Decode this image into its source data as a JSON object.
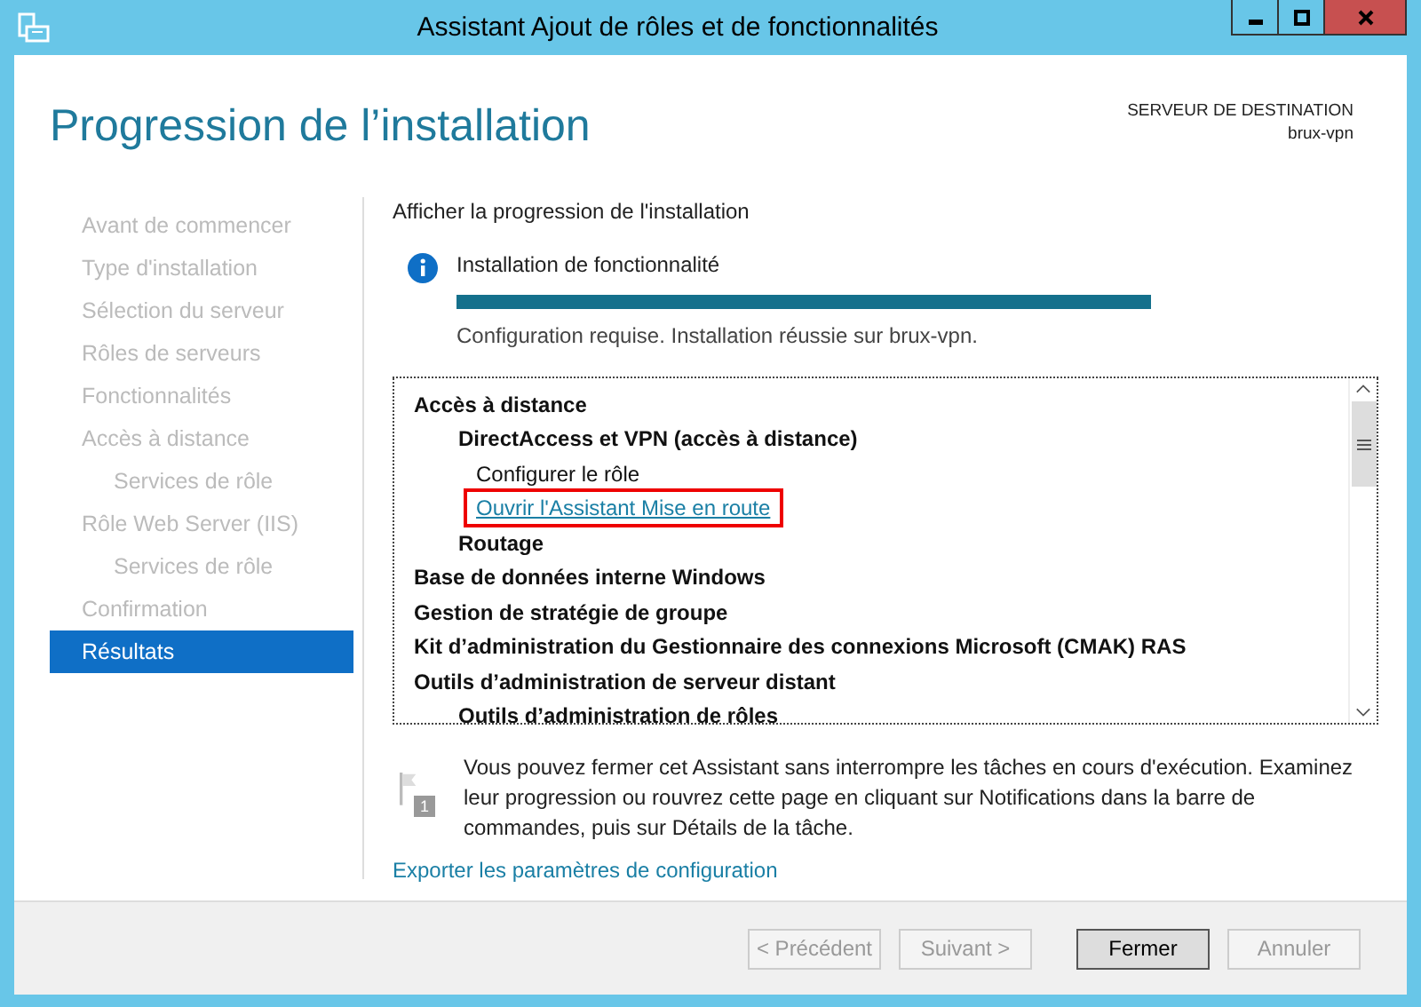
{
  "window": {
    "title": "Assistant Ajout de rôles et de fonctionnalités"
  },
  "header": {
    "title": "Progression de l’installation",
    "destination_label": "SERVEUR DE DESTINATION",
    "destination_server": "brux-vpn"
  },
  "sidebar": {
    "items": [
      {
        "label": "Avant de commencer",
        "selected": false
      },
      {
        "label": "Type d'installation",
        "selected": false
      },
      {
        "label": "Sélection du serveur",
        "selected": false
      },
      {
        "label": "Rôles de serveurs",
        "selected": false
      },
      {
        "label": "Fonctionnalités",
        "selected": false
      },
      {
        "label": "Accès à distance",
        "selected": false,
        "children": [
          {
            "label": "Services de rôle",
            "selected": false
          }
        ]
      },
      {
        "label": "Rôle Web Server (IIS)",
        "selected": false,
        "children": [
          {
            "label": "Services de rôle",
            "selected": false
          }
        ]
      },
      {
        "label": "Confirmation",
        "selected": false
      },
      {
        "label": "Résultats",
        "selected": true
      }
    ]
  },
  "content": {
    "heading": "Afficher la progression de l'installation",
    "status": {
      "title": "Installation de fonctionnalité",
      "level": 1,
      "message": "Configuration requise. Installation réussie sur brux-vpn."
    },
    "results": [
      {
        "label": "Accès à distance",
        "kind": "feature",
        "children": [
          {
            "label": "DirectAccess et VPN (accès à distance)",
            "kind": "feature",
            "children": [
              {
                "label": "Configurer le rôle",
                "kind": "task"
              },
              {
                "label": "Ouvrir l'Assistant Mise en route",
                "kind": "link",
                "highlighted": true
              }
            ]
          },
          {
            "label": "Routage",
            "kind": "feature"
          }
        ]
      },
      {
        "label": "Base de données interne Windows",
        "kind": "feature"
      },
      {
        "label": "Gestion de stratégie de groupe",
        "kind": "feature"
      },
      {
        "label": "Kit d’administration du Gestionnaire des connexions Microsoft (CMAK) RAS",
        "kind": "feature"
      },
      {
        "label": "Outils d’administration de serveur distant",
        "kind": "feature",
        "children": [
          {
            "label": "Outils d’administration de rôles",
            "kind": "feature"
          }
        ]
      }
    ],
    "notice": {
      "badge": "1",
      "text": "Vous pouvez fermer cet Assistant sans interrompre les tâches en cours d'exécution. Examinez leur progression ou rouvrez cette page en cliquant sur Notifications dans la barre de commandes, puis sur Détails de la tâche."
    },
    "export_link": "Exporter les paramètres de configuration"
  },
  "buttons": [
    {
      "label": "< Précédent",
      "disabled": true,
      "default": false
    },
    {
      "label": "Suivant >",
      "disabled": true,
      "default": false
    },
    {
      "label": "Fermer",
      "disabled": false,
      "default": true
    },
    {
      "label": "Annuler",
      "disabled": true,
      "default": false
    }
  ]
}
